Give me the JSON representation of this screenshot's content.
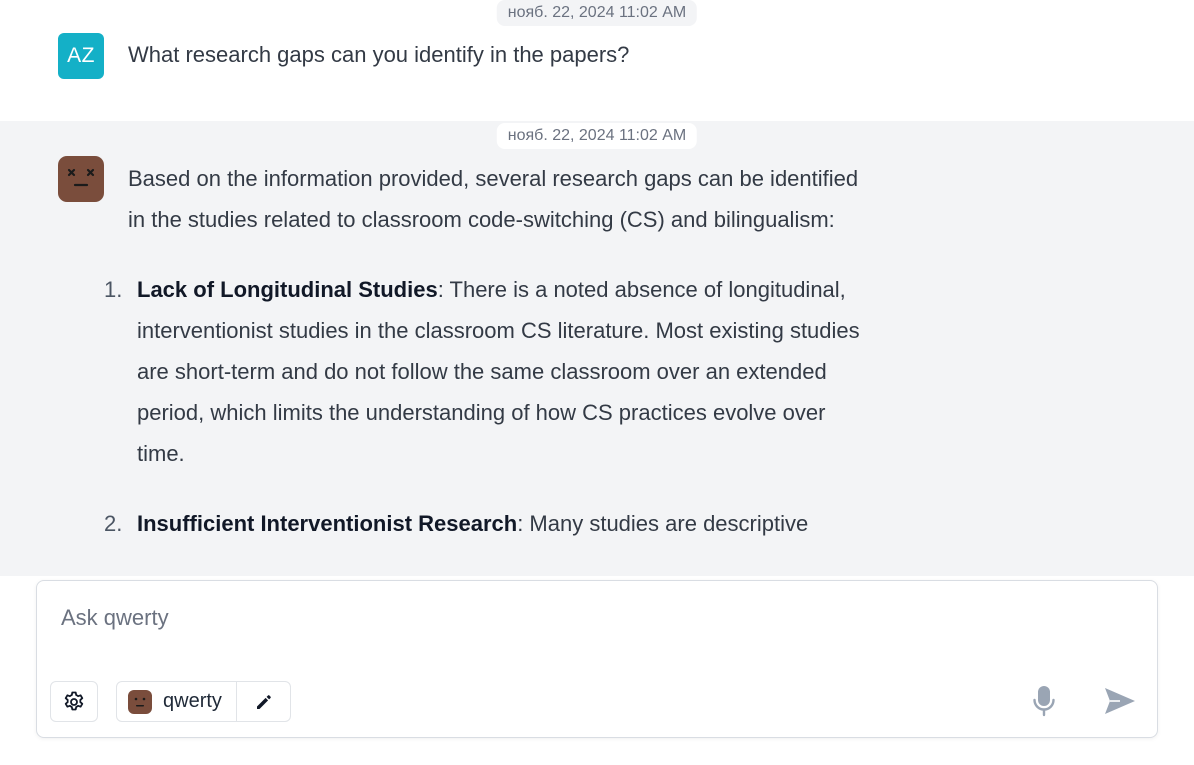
{
  "user_message": {
    "timestamp": "нояб. 22, 2024 11:02 AM",
    "avatar_initials": "AZ",
    "avatar_color": "#14b0c7",
    "text": "What research gaps can you identify in the papers?"
  },
  "bot_message": {
    "timestamp": "нояб. 22, 2024 11:02 AM",
    "avatar_color": "#7a4d3c",
    "intro": "Based on the information provided, several research gaps can be identified in the studies related to classroom code-switching (CS) and bilingualism:",
    "items": [
      {
        "number": "1.",
        "term": "Lack of Longitudinal Studies",
        "text": ": There is a noted absence of longitudinal, interventionist studies in the classroom CS literature. Most existing studies are short-term and do not follow the same classroom over an extended period, which limits the understanding of how CS practices evolve over time."
      },
      {
        "number": "2.",
        "term": "Insufficient Interventionist Research",
        "text": ": Many studies are descriptive"
      }
    ]
  },
  "composer": {
    "placeholder": "Ask qwerty",
    "value": "",
    "model_name": "qwerty",
    "icons": {
      "settings": "gear-icon",
      "edit": "pencil-icon",
      "mic": "microphone-icon",
      "send": "send-icon"
    },
    "icon_color": "#9aa5b4"
  }
}
